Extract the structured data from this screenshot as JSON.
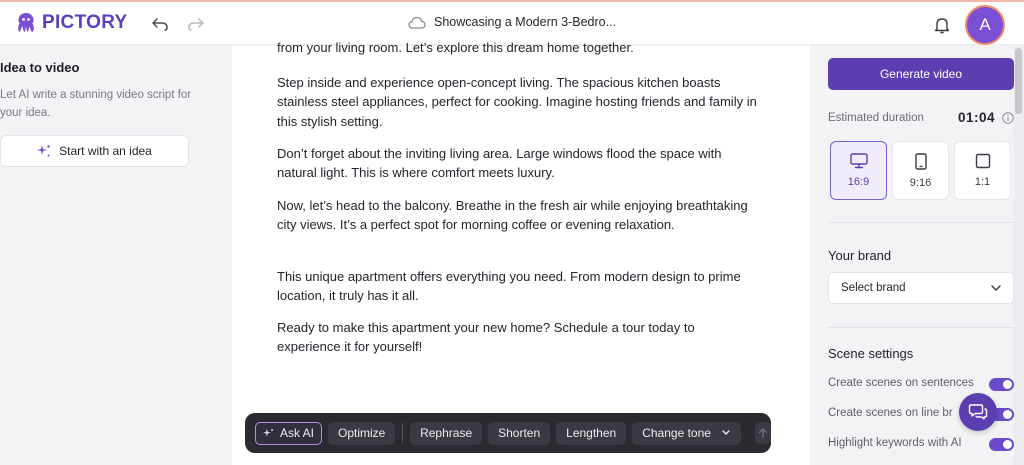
{
  "header": {
    "brand": "PICTORY",
    "doc_title": "Showcasing a Modern 3-Bedro...",
    "avatar_initial": "A"
  },
  "left_panel": {
    "title": "Idea to video",
    "description": "Let AI write a stunning video script for your idea.",
    "start_button": "Start with an idea"
  },
  "editor": {
    "paragraphs": [
      "from your living room. Let’s explore this dream home together.",
      "Step inside and experience open-concept living. The spacious kitchen boasts stainless steel appliances, perfect for cooking. Imagine hosting friends and family in this stylish setting.",
      "Don’t forget about the inviting living area. Large windows flood the space with natural light. This is where comfort meets luxury.",
      "Now, let’s head to the balcony. Breathe in the fresh air while enjoying breathtaking city views. It’s a perfect spot for morning coffee or evening relaxation.",
      "This unique apartment offers everything you need. From modern design to prime location, it truly has it all.",
      "Ready to make this apartment your new home? Schedule a tour today to experience it for yourself!"
    ]
  },
  "ai_toolbar": {
    "ask_ai": "Ask AI",
    "optimize": "Optimize",
    "rephrase": "Rephrase",
    "shorten": "Shorten",
    "lengthen": "Lengthen",
    "change_tone": "Change tone"
  },
  "right_panel": {
    "generate_button": "Generate video",
    "estimated_label": "Estimated duration",
    "estimated_value": "01:04",
    "ratios": [
      {
        "label": "16:9",
        "icon": "monitor-icon",
        "selected": true
      },
      {
        "label": "9:16",
        "icon": "phone-icon",
        "selected": false
      },
      {
        "label": "1:1",
        "icon": "square-icon",
        "selected": false
      }
    ],
    "brand_title": "Your brand",
    "brand_select": "Select brand",
    "scene_title": "Scene settings",
    "toggles": [
      {
        "label": "Create scenes on sentences",
        "on": true
      },
      {
        "label": "Create scenes on line br",
        "on": true
      },
      {
        "label": "Highlight keywords with AI",
        "on": true
      }
    ]
  },
  "colors": {
    "accent": "#5b3fb0",
    "toolbar_bg": "#2a2a30"
  }
}
